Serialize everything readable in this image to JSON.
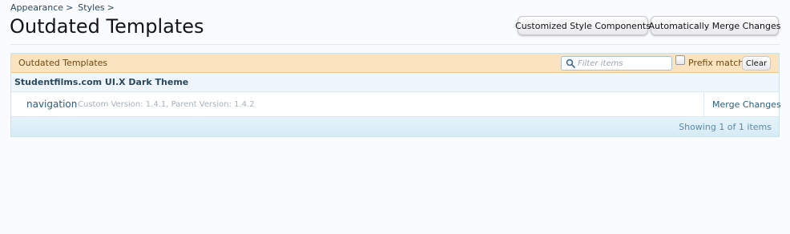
{
  "breadcrumb": {
    "items": [
      "Appearance",
      "Styles"
    ],
    "separator": ">"
  },
  "page_title": "Outdated Templates",
  "top_buttons": {
    "components": "Customized Style Components",
    "merge": "Automatically Merge Changes"
  },
  "list": {
    "header_label": "Outdated Templates",
    "filter_placeholder": "Filter items",
    "filter_value": "",
    "prefix_match_label": "Prefix match",
    "prefix_match_checked": false,
    "clear_label": "Clear",
    "group": {
      "heading": "Studentfilms.com UI.X Dark Theme",
      "rows": [
        {
          "name": "navigation",
          "meta": "Custom Version: 1.4.1, Parent Version: 1.4.2",
          "action": "Merge Changes"
        }
      ]
    },
    "footer_text": "Showing 1 of 1 items"
  },
  "colors": {
    "header_bg": "#fbe3bf",
    "group_bg": "#eef6fb",
    "link": "#2b5d7e",
    "footer_text": "#5d8aa6"
  },
  "icons": {
    "filter": "search-icon"
  }
}
